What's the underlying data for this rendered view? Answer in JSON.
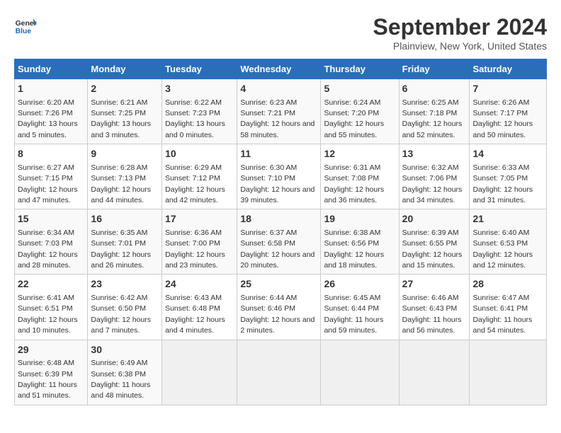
{
  "logo": {
    "line1": "General",
    "line2": "Blue"
  },
  "title": "September 2024",
  "subtitle": "Plainview, New York, United States",
  "days_of_week": [
    "Sunday",
    "Monday",
    "Tuesday",
    "Wednesday",
    "Thursday",
    "Friday",
    "Saturday"
  ],
  "weeks": [
    [
      {
        "day": "1",
        "sunrise": "6:20 AM",
        "sunset": "7:26 PM",
        "daylight": "13 hours and 5 minutes."
      },
      {
        "day": "2",
        "sunrise": "6:21 AM",
        "sunset": "7:25 PM",
        "daylight": "13 hours and 3 minutes."
      },
      {
        "day": "3",
        "sunrise": "6:22 AM",
        "sunset": "7:23 PM",
        "daylight": "13 hours and 0 minutes."
      },
      {
        "day": "4",
        "sunrise": "6:23 AM",
        "sunset": "7:21 PM",
        "daylight": "12 hours and 58 minutes."
      },
      {
        "day": "5",
        "sunrise": "6:24 AM",
        "sunset": "7:20 PM",
        "daylight": "12 hours and 55 minutes."
      },
      {
        "day": "6",
        "sunrise": "6:25 AM",
        "sunset": "7:18 PM",
        "daylight": "12 hours and 52 minutes."
      },
      {
        "day": "7",
        "sunrise": "6:26 AM",
        "sunset": "7:17 PM",
        "daylight": "12 hours and 50 minutes."
      }
    ],
    [
      {
        "day": "8",
        "sunrise": "6:27 AM",
        "sunset": "7:15 PM",
        "daylight": "12 hours and 47 minutes."
      },
      {
        "day": "9",
        "sunrise": "6:28 AM",
        "sunset": "7:13 PM",
        "daylight": "12 hours and 44 minutes."
      },
      {
        "day": "10",
        "sunrise": "6:29 AM",
        "sunset": "7:12 PM",
        "daylight": "12 hours and 42 minutes."
      },
      {
        "day": "11",
        "sunrise": "6:30 AM",
        "sunset": "7:10 PM",
        "daylight": "12 hours and 39 minutes."
      },
      {
        "day": "12",
        "sunrise": "6:31 AM",
        "sunset": "7:08 PM",
        "daylight": "12 hours and 36 minutes."
      },
      {
        "day": "13",
        "sunrise": "6:32 AM",
        "sunset": "7:06 PM",
        "daylight": "12 hours and 34 minutes."
      },
      {
        "day": "14",
        "sunrise": "6:33 AM",
        "sunset": "7:05 PM",
        "daylight": "12 hours and 31 minutes."
      }
    ],
    [
      {
        "day": "15",
        "sunrise": "6:34 AM",
        "sunset": "7:03 PM",
        "daylight": "12 hours and 28 minutes."
      },
      {
        "day": "16",
        "sunrise": "6:35 AM",
        "sunset": "7:01 PM",
        "daylight": "12 hours and 26 minutes."
      },
      {
        "day": "17",
        "sunrise": "6:36 AM",
        "sunset": "7:00 PM",
        "daylight": "12 hours and 23 minutes."
      },
      {
        "day": "18",
        "sunrise": "6:37 AM",
        "sunset": "6:58 PM",
        "daylight": "12 hours and 20 minutes."
      },
      {
        "day": "19",
        "sunrise": "6:38 AM",
        "sunset": "6:56 PM",
        "daylight": "12 hours and 18 minutes."
      },
      {
        "day": "20",
        "sunrise": "6:39 AM",
        "sunset": "6:55 PM",
        "daylight": "12 hours and 15 minutes."
      },
      {
        "day": "21",
        "sunrise": "6:40 AM",
        "sunset": "6:53 PM",
        "daylight": "12 hours and 12 minutes."
      }
    ],
    [
      {
        "day": "22",
        "sunrise": "6:41 AM",
        "sunset": "6:51 PM",
        "daylight": "12 hours and 10 minutes."
      },
      {
        "day": "23",
        "sunrise": "6:42 AM",
        "sunset": "6:50 PM",
        "daylight": "12 hours and 7 minutes."
      },
      {
        "day": "24",
        "sunrise": "6:43 AM",
        "sunset": "6:48 PM",
        "daylight": "12 hours and 4 minutes."
      },
      {
        "day": "25",
        "sunrise": "6:44 AM",
        "sunset": "6:46 PM",
        "daylight": "12 hours and 2 minutes."
      },
      {
        "day": "26",
        "sunrise": "6:45 AM",
        "sunset": "6:44 PM",
        "daylight": "11 hours and 59 minutes."
      },
      {
        "day": "27",
        "sunrise": "6:46 AM",
        "sunset": "6:43 PM",
        "daylight": "11 hours and 56 minutes."
      },
      {
        "day": "28",
        "sunrise": "6:47 AM",
        "sunset": "6:41 PM",
        "daylight": "11 hours and 54 minutes."
      }
    ],
    [
      {
        "day": "29",
        "sunrise": "6:48 AM",
        "sunset": "6:39 PM",
        "daylight": "11 hours and 51 minutes."
      },
      {
        "day": "30",
        "sunrise": "6:49 AM",
        "sunset": "6:38 PM",
        "daylight": "11 hours and 48 minutes."
      },
      null,
      null,
      null,
      null,
      null
    ]
  ],
  "labels": {
    "sunrise": "Sunrise:",
    "sunset": "Sunset:",
    "daylight": "Daylight:"
  },
  "colors": {
    "header_bg": "#2a6ebb",
    "header_text": "#ffffff"
  }
}
